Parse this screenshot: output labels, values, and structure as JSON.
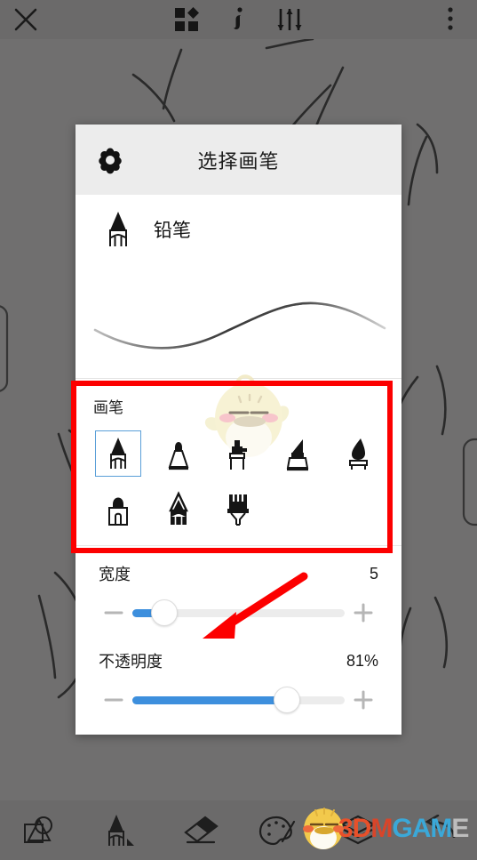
{
  "app": {
    "background_color": "#706f6f",
    "panel_color": "#ffffff",
    "accent_color": "#3d8fdd",
    "annotation_color": "#fc0000"
  },
  "topbar": {
    "close_label": "close-icon",
    "items": [
      {
        "name": "close",
        "icon": "close-icon"
      },
      {
        "name": "shapes",
        "icon": "shapes-grid-icon"
      },
      {
        "name": "info",
        "icon": "info-icon"
      },
      {
        "name": "adjust",
        "icon": "sliders-icon"
      },
      {
        "name": "more",
        "icon": "overflow-menu-icon"
      }
    ]
  },
  "dialog": {
    "title": "选择画笔",
    "gear_icon": "gear-icon",
    "current_brush": {
      "name": "铅笔",
      "icon": "pencil-icon"
    },
    "preview_alt": "brush-stroke-preview",
    "brush_section": {
      "title": "画笔",
      "selected_index": 0,
      "items": [
        {
          "icon": "pencil-icon",
          "selected": true
        },
        {
          "icon": "marker-pen-icon",
          "selected": false
        },
        {
          "icon": "airbrush-icon",
          "selected": false
        },
        {
          "icon": "chisel-marker-icon",
          "selected": false
        },
        {
          "icon": "ink-brush-icon",
          "selected": false
        },
        {
          "icon": "wide-marker-icon",
          "selected": false
        },
        {
          "icon": "soft-pencil-icon",
          "selected": false
        },
        {
          "icon": "bristle-brush-icon",
          "selected": false
        }
      ]
    },
    "sliders": [
      {
        "label": "宽度",
        "value_text": "5",
        "percent": 15,
        "minus_label": "−",
        "plus_label": "+"
      },
      {
        "label": "不透明度",
        "value_text": "81%",
        "percent": 73,
        "minus_label": "−",
        "plus_label": "+"
      }
    ]
  },
  "bottombar": {
    "items": [
      {
        "name": "shapes",
        "icon": "shapes-tool-icon"
      },
      {
        "name": "pencil",
        "icon": "pencil-tool-icon"
      },
      {
        "name": "eraser",
        "icon": "eraser-tool-icon"
      },
      {
        "name": "palette",
        "icon": "palette-tool-icon"
      },
      {
        "name": "layers",
        "icon": "layers-tool-icon"
      },
      {
        "name": "undo",
        "icon": "undo-arrow-icon"
      }
    ]
  },
  "watermark": {
    "part1": "3D",
    "part2": "M",
    "part3": "GAM",
    "part4": "E",
    "logo": "chick-mascot-icon"
  }
}
